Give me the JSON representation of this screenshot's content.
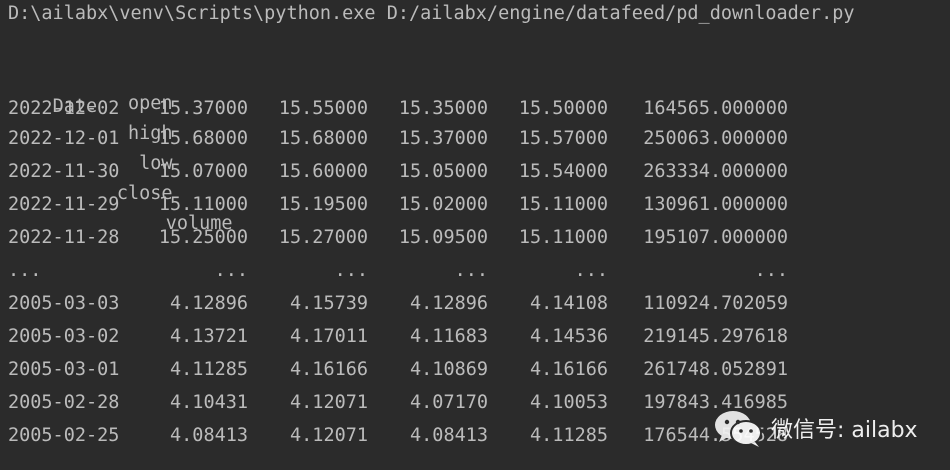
{
  "command": "D:\\ailabx\\venv\\Scripts\\python.exe D:/ailabx/engine/datafeed/pd_downloader.py",
  "table": {
    "columns": [
      "open",
      "high",
      "low",
      "close",
      "volume"
    ],
    "index_name": "Date",
    "rows": [
      [
        "2022-12-02",
        "15.37000",
        "15.55000",
        "15.35000",
        "15.50000",
        "164565.000000"
      ],
      [
        "2022-12-01",
        "15.68000",
        "15.68000",
        "15.37000",
        "15.57000",
        "250063.000000"
      ],
      [
        "2022-11-30",
        "15.07000",
        "15.60000",
        "15.05000",
        "15.54000",
        "263334.000000"
      ],
      [
        "2022-11-29",
        "15.11000",
        "15.19500",
        "15.02000",
        "15.11000",
        "130961.000000"
      ],
      [
        "2022-11-28",
        "15.25000",
        "15.27000",
        "15.09500",
        "15.11000",
        "195107.000000"
      ],
      [
        "...",
        "...",
        "...",
        "...",
        "...",
        "..."
      ],
      [
        "2005-03-03",
        "4.12896",
        "4.15739",
        "4.12896",
        "4.14108",
        "110924.702059"
      ],
      [
        "2005-03-02",
        "4.13721",
        "4.17011",
        "4.11683",
        "4.14536",
        "219145.297618"
      ],
      [
        "2005-03-01",
        "4.11285",
        "4.16166",
        "4.10869",
        "4.16166",
        "261748.052891"
      ],
      [
        "2005-02-28",
        "4.10431",
        "4.12071",
        "4.07170",
        "4.10053",
        "197843.416985"
      ],
      [
        "2005-02-25",
        "4.08413",
        "4.12071",
        "4.08413",
        "4.11285",
        "176544.554528"
      ]
    ]
  },
  "watermark": {
    "text": "微信号: ailabx",
    "icon": "wechat-icon"
  },
  "colors": {
    "background": "#2b2b2b",
    "text": "#bbbbbb",
    "watermark": "#ffffff"
  }
}
